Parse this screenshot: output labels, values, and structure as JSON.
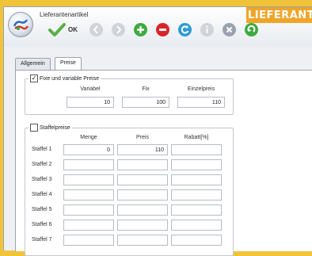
{
  "window": {
    "title": "Lieferantenartikel"
  },
  "banner": {
    "text": "LIEFERANT"
  },
  "toolbar": {
    "ok_label": "OK",
    "buttons": [
      {
        "icon": "check-icon",
        "color": "#4caf50"
      },
      {
        "icon": "back-icon",
        "color": "#c7ccd2"
      },
      {
        "icon": "forward-icon",
        "color": "#c7ccd2"
      },
      {
        "icon": "add-icon",
        "color": "#3dab3d"
      },
      {
        "icon": "delete-icon",
        "color": "#d9242b"
      },
      {
        "icon": "refresh-icon",
        "color": "#2e9bd6"
      },
      {
        "icon": "info-icon",
        "color": "#c7ccd2"
      },
      {
        "icon": "close-icon",
        "color": "#9aa3ad"
      },
      {
        "icon": "redo-icon",
        "color": "#3dab3d"
      }
    ]
  },
  "tabs": [
    {
      "label": "Allgemein",
      "active": false
    },
    {
      "label": "Preise",
      "active": true
    }
  ],
  "prices": {
    "checkbox_label": "Fixe und variable Preise",
    "checked": true,
    "headers": {
      "variabel": "Variabel",
      "fix": "Fix",
      "einzel": "Einzelpreis"
    },
    "values": {
      "variabel": "10",
      "fix": "100",
      "einzel": "110"
    }
  },
  "staffel": {
    "checkbox_label": "Staffelpreise",
    "checked": false,
    "headers": {
      "menge": "Menge",
      "preis": "Preis",
      "rabatt": "Rabatt[%]"
    },
    "rows": [
      {
        "label": "Staffel 1",
        "menge": "0",
        "preis": "110",
        "rabatt": ""
      },
      {
        "label": "Staffel 2",
        "menge": "",
        "preis": "",
        "rabatt": ""
      },
      {
        "label": "Staffel 3",
        "menge": "",
        "preis": "",
        "rabatt": ""
      },
      {
        "label": "Staffel 4",
        "menge": "",
        "preis": "",
        "rabatt": ""
      },
      {
        "label": "Staffel 5",
        "menge": "",
        "preis": "",
        "rabatt": ""
      },
      {
        "label": "Staffel 6",
        "menge": "",
        "preis": "",
        "rabatt": ""
      },
      {
        "label": "Staffel 7",
        "menge": "",
        "preis": "",
        "rabatt": ""
      }
    ]
  }
}
